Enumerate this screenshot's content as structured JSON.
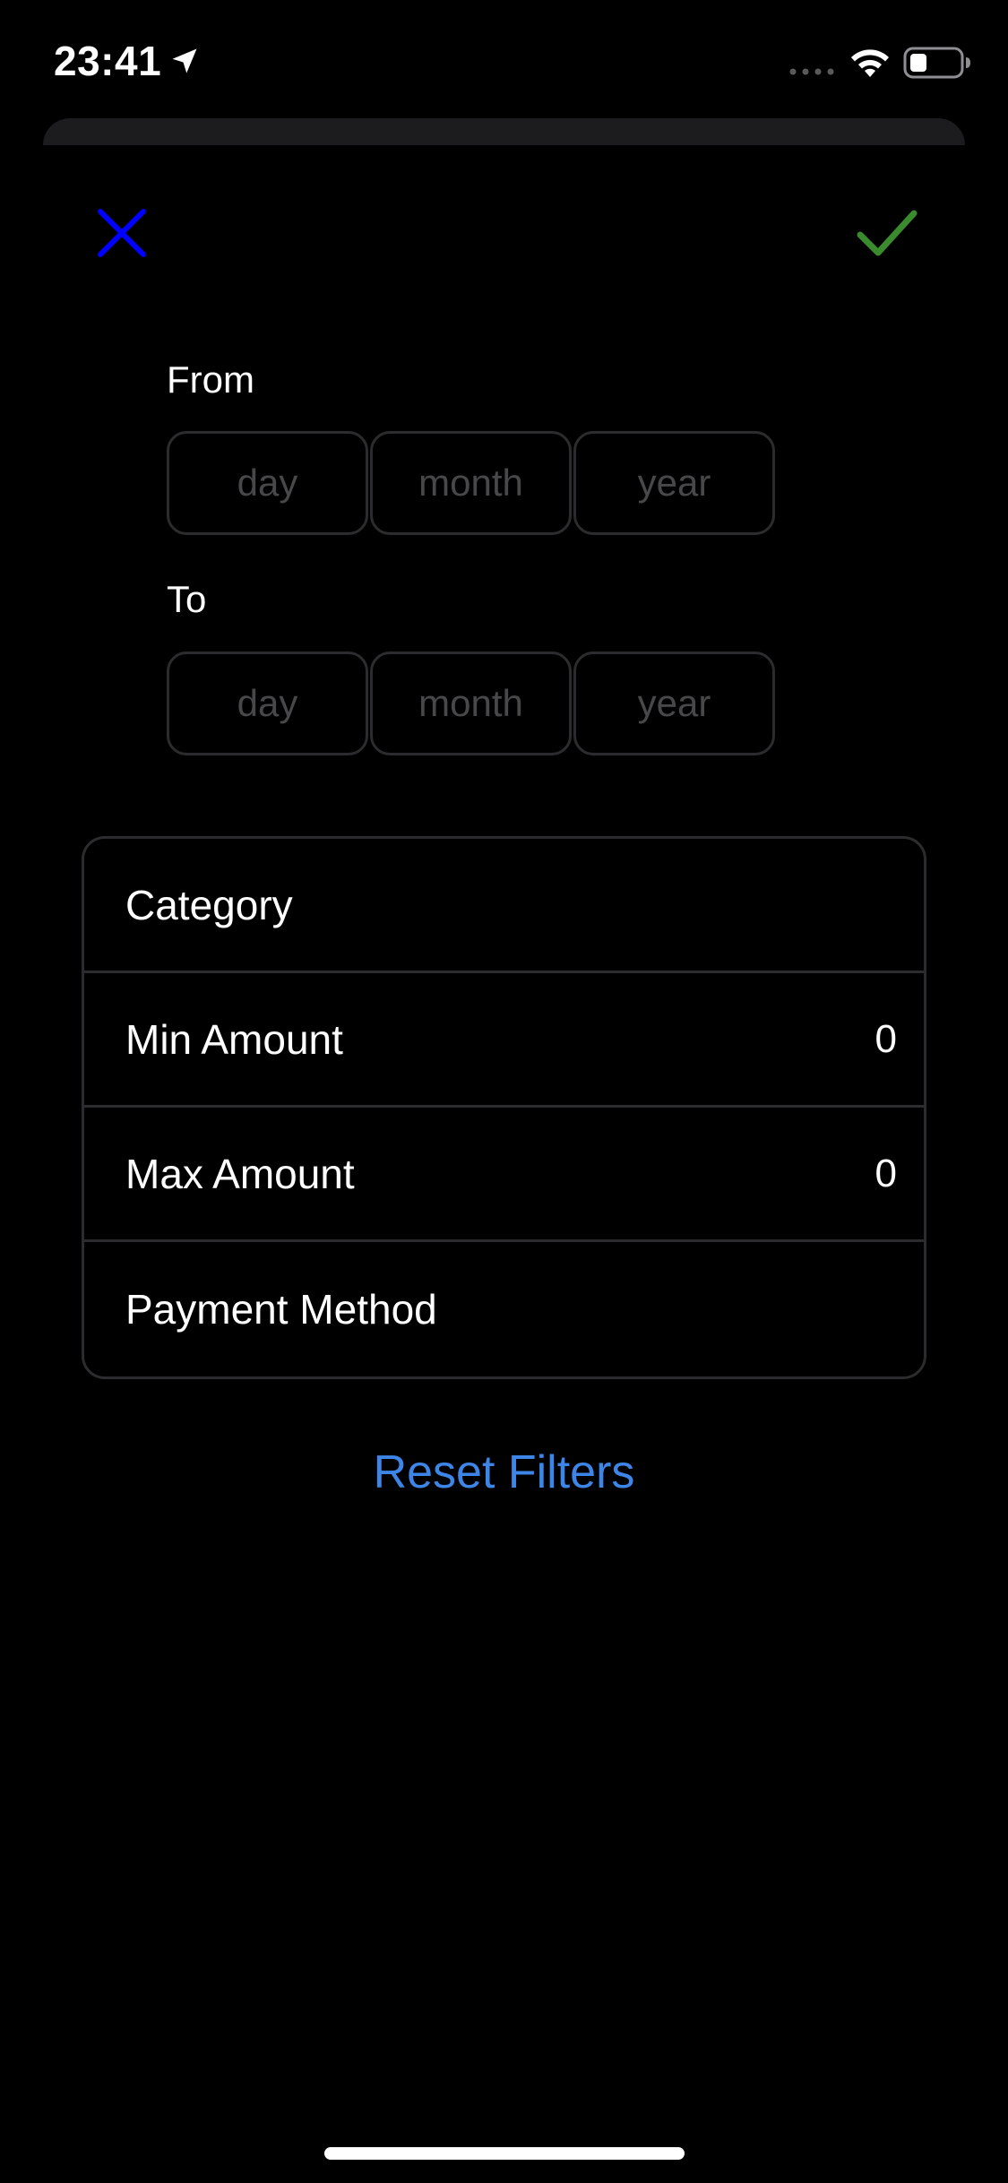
{
  "status_bar": {
    "time": "23:41",
    "icons": [
      "location-arrow-icon",
      "cellular-signal-icon",
      "wifi-icon",
      "battery-icon"
    ]
  },
  "toolbar": {
    "close_icon": "close-icon",
    "confirm_icon": "checkmark-icon",
    "close_color": "#0000ff",
    "confirm_color": "#3a8a2e"
  },
  "date_range": {
    "from_label": "From",
    "to_label": "To",
    "from": {
      "day_placeholder": "day",
      "month_placeholder": "month",
      "year_placeholder": "year",
      "day_value": "",
      "month_value": "",
      "year_value": ""
    },
    "to": {
      "day_placeholder": "day",
      "month_placeholder": "month",
      "year_placeholder": "year",
      "day_value": "",
      "month_value": "",
      "year_value": ""
    }
  },
  "filters": {
    "category_label": "Category",
    "min_amount_label": "Min Amount",
    "min_amount_value": "0",
    "max_amount_label": "Max Amount",
    "max_amount_value": "0",
    "payment_method_label": "Payment Method"
  },
  "actions": {
    "reset_label": "Reset Filters",
    "reset_color": "#3d85e6"
  }
}
